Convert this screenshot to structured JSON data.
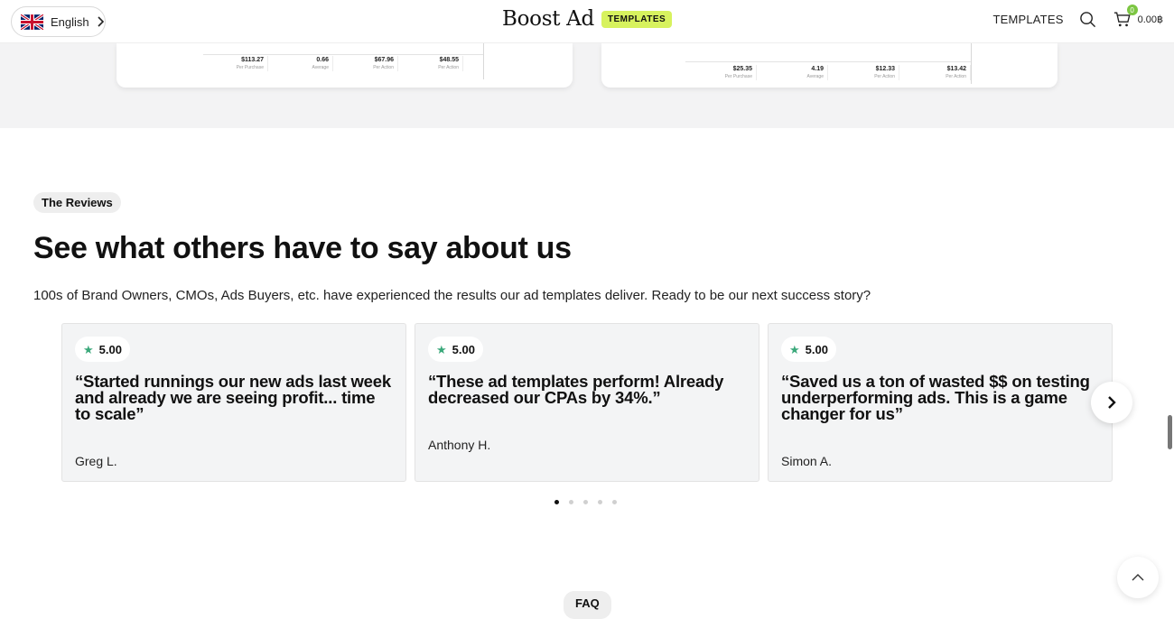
{
  "header": {
    "language": "English",
    "logo_text": "Boost Ad",
    "logo_badge": "TEMPLATES",
    "nav_templates": "TEMPLATES",
    "cart_count": "0",
    "cart_total": "0.00฿",
    "icons": [
      "uk-flag-icon",
      "chevron-right-icon",
      "search-icon",
      "cart-icon",
      "chevron-up-icon"
    ]
  },
  "top_cards": {
    "left": [
      {
        "value": "$113.27",
        "label": "Per Purchase"
      },
      {
        "value": "0.66",
        "label": "Average"
      },
      {
        "value": "$67.96",
        "label": "Per Action"
      },
      {
        "value": "$48.55",
        "label": "Per Action"
      }
    ],
    "right": [
      {
        "value": "$25.35",
        "label": "Per Purchase"
      },
      {
        "value": "4.19",
        "label": "Average"
      },
      {
        "value": "$12.33",
        "label": "Per Action"
      },
      {
        "value": "$13.42",
        "label": "Per Action"
      }
    ]
  },
  "reviews_section": {
    "pill": "The Reviews",
    "title": "See what others have to say about us",
    "lead": "100s of Brand Owners, CMOs, Ads Buyers, etc. have experienced the results our ad templates deliver. Ready to be our next success story?",
    "items": [
      {
        "rating": "5.00",
        "quote": "“Started runnings our new ads last week and already we are seeing profit... time to scale”",
        "author": "Greg L."
      },
      {
        "rating": "5.00",
        "quote": "“These ad templates perform! Already decreased our CPAs by 34%.”",
        "author": "Anthony H."
      },
      {
        "rating": "5.00",
        "quote": "“Saved us a ton of wasted $$ on testing underperforming ads. This is a game changer for us”",
        "author": "Simon A."
      }
    ],
    "pagination": {
      "total": 5,
      "active": 1
    }
  },
  "faq": {
    "pill": "FAQ"
  },
  "colors": {
    "accent_badge": "#d7f25e",
    "star": "#3aa87a",
    "cart_badge": "#7cc642",
    "section_bg": "#f3f3f4"
  }
}
